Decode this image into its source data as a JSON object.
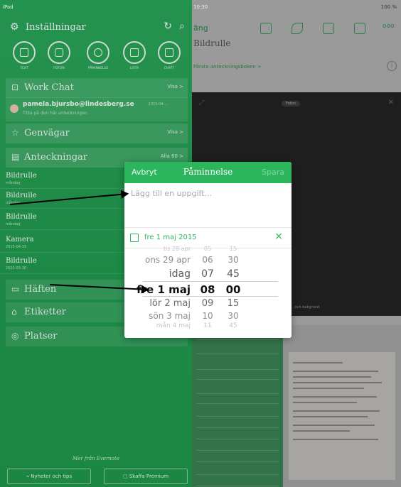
{
  "status_bar": {
    "left": "iPad",
    "time": "10:30",
    "battery": "100 %"
  },
  "sidebar": {
    "title": "Inställningar",
    "quick_actions": [
      {
        "label": "TEXT",
        "icon": "text-note-icon"
      },
      {
        "label": "FOTON",
        "icon": "camera-icon"
      },
      {
        "label": "PÅMINNELSE",
        "icon": "reminder-icon"
      },
      {
        "label": "LISTA",
        "icon": "checklist-icon"
      },
      {
        "label": "CHATT",
        "icon": "chat-icon"
      }
    ],
    "work_chat": {
      "title": "Work Chat",
      "action": "Visa >",
      "email": "pamela.bjursbo@lindesberg.se",
      "subtitle": "Titta på den här anteckningen",
      "date": "2015-04-..."
    },
    "shortcuts": {
      "title": "Genvägar",
      "action": "Visa >"
    },
    "notes": {
      "title": "Anteckningar",
      "action": "Alla 60 >",
      "items": [
        {
          "title": "Bildrulle",
          "date": "måndag"
        },
        {
          "title": "Bildrulle",
          "date": "måndag"
        },
        {
          "title": "Bildrulle",
          "date": "måndag"
        },
        {
          "title": "Kamera",
          "date": "2015-04-15"
        },
        {
          "title": "Bildrulle",
          "date": "2015-03-30"
        }
      ]
    },
    "notebooks": {
      "title": "Häften"
    },
    "tags": {
      "title": "Etiketter"
    },
    "places": {
      "title": "Platser"
    },
    "footer": "Mer från Evernote",
    "news_button": "Nyheter och tips",
    "premium_button": "Skaffa Premium"
  },
  "note_view": {
    "back": "äng",
    "title": "Bildrulle",
    "notebook": "Första anteckningsboken >",
    "media_pill": "Foton",
    "info": "i",
    "hint": "...och bakgrund."
  },
  "popup": {
    "cancel": "Avbryt",
    "title": "Påminnelse",
    "save": "Spara",
    "placeholder": "Lägg till en uppgift...",
    "date": "fre 1 maj 2015",
    "clear": "×",
    "picker": [
      {
        "day": "tis 28 apr",
        "hour": "05",
        "minute": "15"
      },
      {
        "day": "ons 29 apr",
        "hour": "06",
        "minute": "30"
      },
      {
        "day": "idag",
        "hour": "07",
        "minute": "45"
      },
      {
        "day": "fre 1 maj",
        "hour": "08",
        "minute": "00"
      },
      {
        "day": "lör 2 maj",
        "hour": "09",
        "minute": "15"
      },
      {
        "day": "sön 3 maj",
        "hour": "10",
        "minute": "30"
      },
      {
        "day": "mån 4 maj",
        "hour": "11",
        "minute": "45"
      }
    ]
  },
  "colors": {
    "brand_green": "#2db55d",
    "sidebar_green": "#249e52",
    "overlay_dim": "#000000"
  }
}
